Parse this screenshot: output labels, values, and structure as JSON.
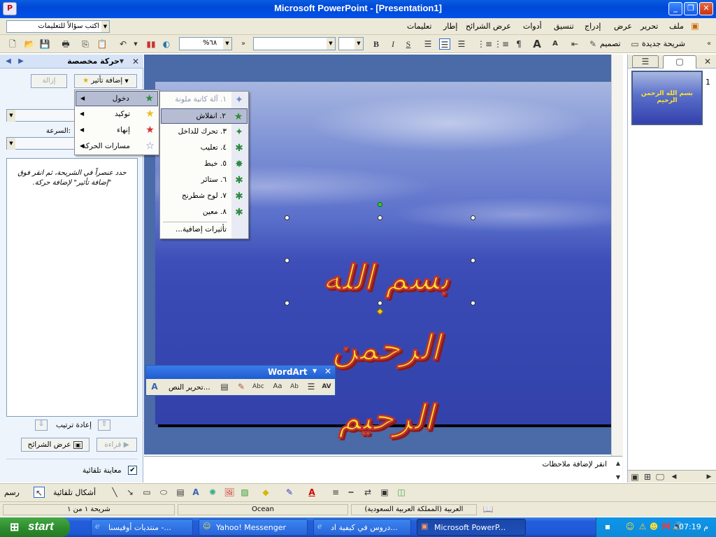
{
  "window": {
    "title": "Microsoft PowerPoint - [Presentation1]"
  },
  "menubar": {
    "help_placeholder": "اكتب سؤالاً للتعليمات",
    "items": [
      "ملف",
      "تحرير",
      "عرض",
      "إدراج",
      "تنسيق",
      "أدوات",
      "عرض الشرائح",
      "إطار",
      "تعليمات"
    ]
  },
  "toolbar": {
    "zoom": "%٦٨",
    "new_slide": "شريحة جديدة",
    "design": "تصميم"
  },
  "taskpane": {
    "title": "حركة مخصصة",
    "add_effect": "إضافة تأثير",
    "remove": "إزالة",
    "speed_label": "السرعة:",
    "hint": "حدد عنصراً في الشريحة، ثم انقر فوق \"إضافة تأثير\" لإضافة حركة.",
    "reorder": "إعادة ترتيب",
    "play": "قراءة",
    "slideshow": "عرض الشرائح",
    "autopreview": "معاينة تلقائية"
  },
  "effect_menu": [
    {
      "label": "دخول",
      "icon": "entrance-star-icon",
      "color": "#2e8b3e"
    },
    {
      "label": "توكيد",
      "icon": "emphasis-star-icon",
      "color": "#e8c020"
    },
    {
      "label": "إنهاء",
      "icon": "exit-star-icon",
      "color": "#d83030"
    },
    {
      "label": "مسارات الحركة",
      "icon": "motion-path-star-icon",
      "color": "#6688bb"
    }
  ],
  "entrance_menu": [
    "١. آلة كاتبة ملونة",
    "٢. انفلاش",
    "٣. تحرك للداخل",
    "٤. تعليب",
    "٥. خبط",
    "٦. ستائر",
    "٧. لوح شطرنج",
    "٨. معين",
    "تأثيرات إضافية..."
  ],
  "slide": {
    "wordart_text": "بسم الله الرحمن الرحيم"
  },
  "thumbnail": {
    "number": "1",
    "text": "بسم الله الرحمن الرحيم"
  },
  "wordart_bar": {
    "title": "WordArt",
    "edit_text": "تحرير النص..."
  },
  "notes": {
    "placeholder": "انقر لإضافة ملاحظات"
  },
  "drawbar": {
    "draw": "رسم",
    "autoshapes": "أشكال تلقائية"
  },
  "status": {
    "slide": "شريحة ١ من ١",
    "design": "Ocean",
    "language": "العربية (المملكة العربية السعودية)"
  },
  "taskbar": {
    "start": "start",
    "tasks": [
      "منتديات أوفيسنا -...",
      "Yahoo! Messenger",
      "دروس في كيفية اد...",
      "Microsoft PowerP..."
    ],
    "clock": "07:19 م"
  }
}
